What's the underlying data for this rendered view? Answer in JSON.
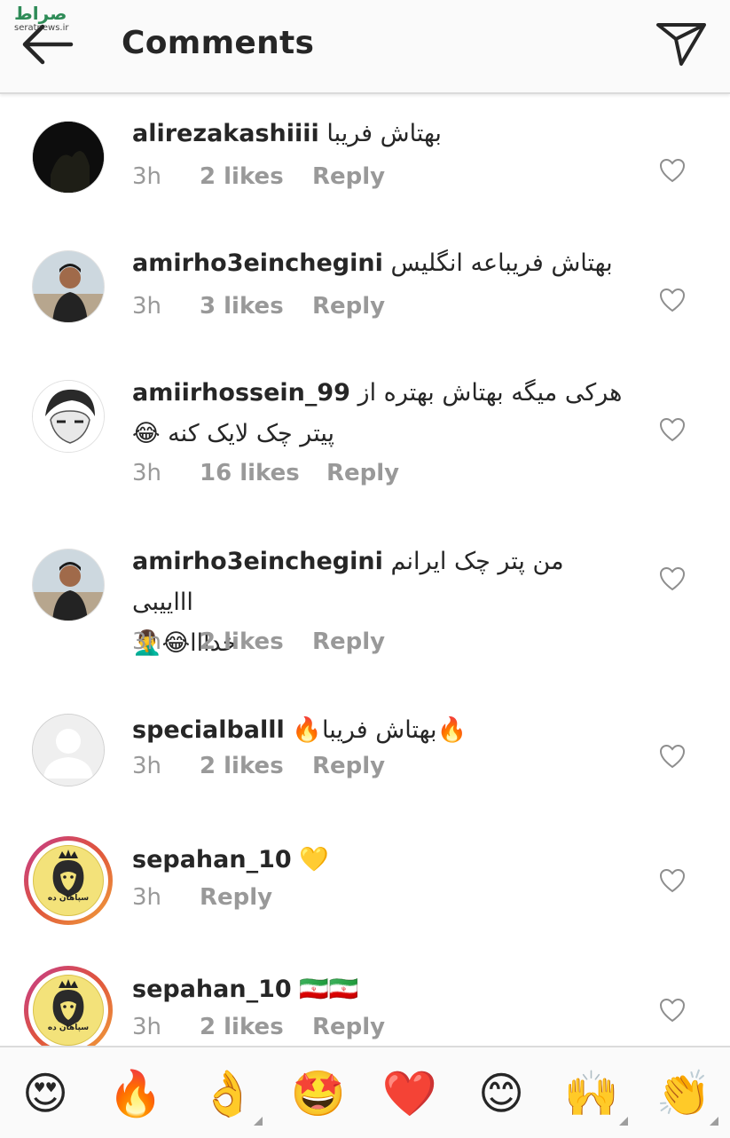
{
  "header": {
    "title": "Comments",
    "watermark_logo": "صراط",
    "watermark_site": "seratnews.ir"
  },
  "comments": [
    {
      "username": "alirezakashiiii",
      "text": "بهتاش فریبا",
      "time": "3h",
      "likes": "2 likes",
      "reply": "Reply"
    },
    {
      "username": "amirho3einchegini",
      "text": "بهتاش فریباعه انگلیس",
      "time": "3h",
      "likes": "3 likes",
      "reply": "Reply"
    },
    {
      "username": "amiirhossein_99",
      "text": "هرکی میگه بهتاش بهتره از",
      "text2": "پیتر چک لایک کنه 😂",
      "time": "3h",
      "likes": "16 likes",
      "reply": "Reply"
    },
    {
      "username": "amirho3einchegini",
      "text": "من پتر چک ایرانم اااییبی",
      "text2": "خدااا😂🤦‍♂️",
      "time": "3h",
      "likes": "2 likes",
      "reply": "Reply"
    },
    {
      "username": "specialballl",
      "text": "🔥بهتاش فریبا🔥",
      "time": "3h",
      "likes": "2 likes",
      "reply": "Reply"
    },
    {
      "username": "sepahan_10",
      "text": "💛",
      "time": "3h",
      "likes": "",
      "reply": "Reply",
      "avatar_caption": "سپاهان ده"
    },
    {
      "username": "sepahan_10",
      "text": "🇮🇷🇮🇷",
      "time": "3h",
      "likes": "2 likes",
      "reply": "Reply",
      "avatar_caption": "سپاهان ده"
    }
  ],
  "emoji_bar": [
    "😍",
    "🔥",
    "👌",
    "🤩",
    "❤️",
    "😊",
    "🙌",
    "👏"
  ],
  "colors": {
    "text": "#262626",
    "meta": "#999999",
    "header_bg": "#fafafa",
    "divider": "#dbdbdb",
    "story_ring": "#e0553c"
  }
}
